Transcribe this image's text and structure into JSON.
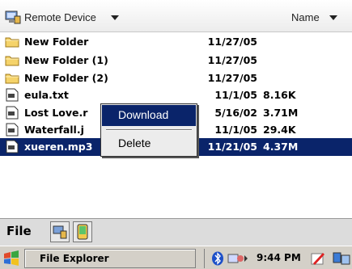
{
  "header": {
    "location_label": "Remote Device",
    "sort_label": "Name"
  },
  "files": [
    {
      "name": "New Folder",
      "date": "11/27/05",
      "size": "",
      "type": "folder-icon"
    },
    {
      "name": "New Folder (1)",
      "date": "11/27/05",
      "size": "",
      "type": "folder-icon"
    },
    {
      "name": "New Folder (2)",
      "date": "11/27/05",
      "size": "",
      "type": "folder-icon"
    },
    {
      "name": "eula.txt",
      "date": "11/1/05",
      "size": "8.16K",
      "type": "file-icon"
    },
    {
      "name": "Lost Love.r",
      "date": "5/16/02",
      "size": "3.71M",
      "type": "file-icon"
    },
    {
      "name": "Waterfall.j",
      "date": "11/1/05",
      "size": "29.4K",
      "type": "file-icon"
    },
    {
      "name": "xueren.mp3",
      "date": "11/21/05",
      "size": "4.37M",
      "type": "file-icon",
      "selected": true
    }
  ],
  "context_menu": {
    "download": "Download",
    "delete": "Delete"
  },
  "menu_bar": {
    "file": "File"
  },
  "taskbar": {
    "app": "File Explorer",
    "clock": "9:44 PM"
  },
  "colors": {
    "selection": "#0a246a",
    "menu_bg": "#ececec",
    "taskbar_bg": "#d4d0c8"
  }
}
